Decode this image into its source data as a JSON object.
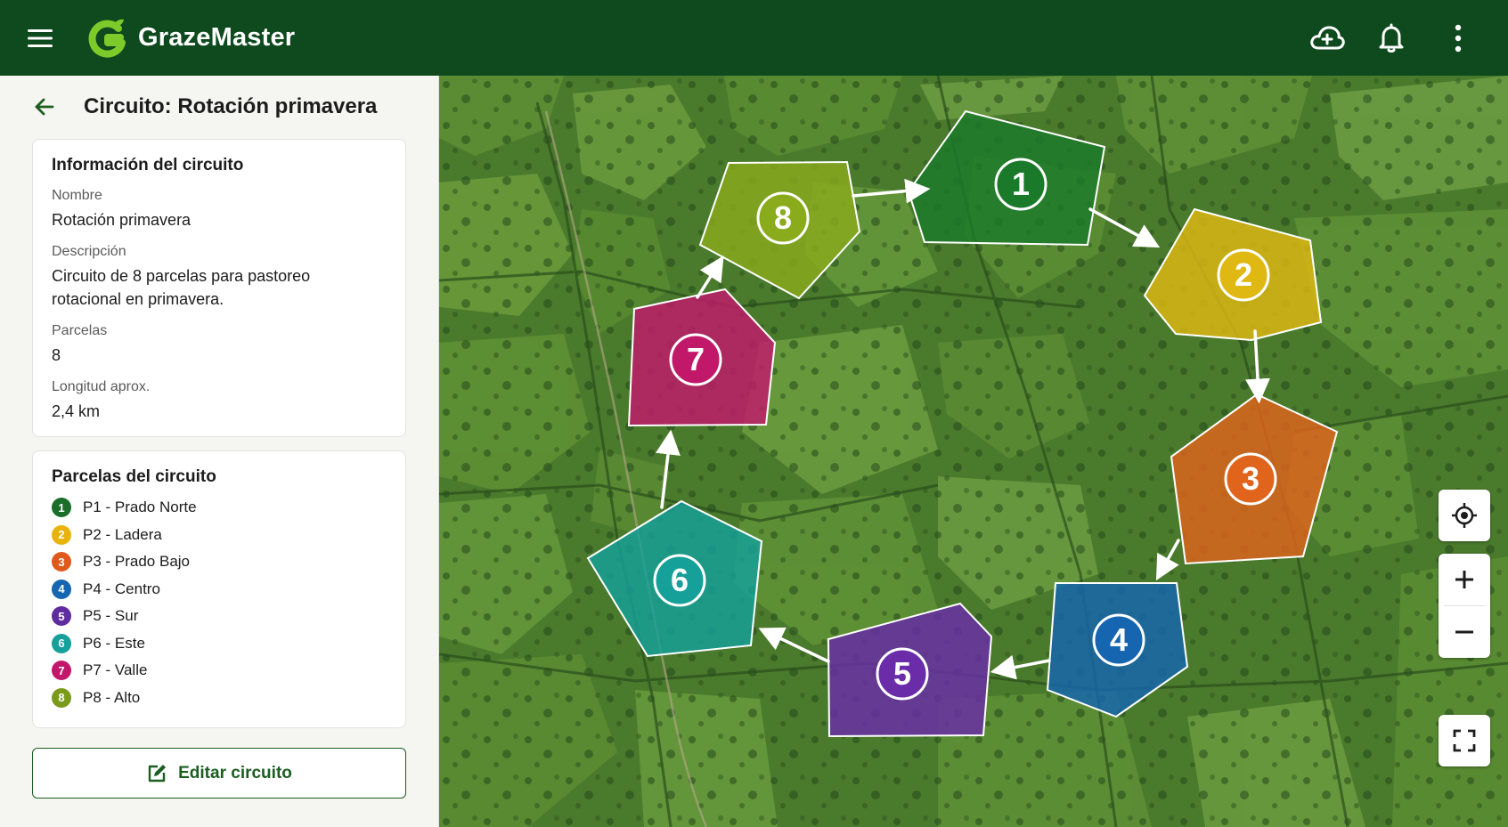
{
  "app": {
    "name": "GrazeMaster",
    "brand_color": "#0e4a1d",
    "icons": {
      "menu": "hamburger-menu-icon",
      "logo": "grazemaster-logo",
      "sync": "cloud-sync-icon",
      "notifications": "bell-icon",
      "more": "more-vert-icon"
    }
  },
  "sidebar": {
    "title": "Circuito: Rotación primavera",
    "info_card": {
      "title": "Información del circuito",
      "fields": [
        {
          "label": "Nombre",
          "value": "Rotación primavera"
        },
        {
          "label": "Descripción",
          "value": "Circuito de 8 parcelas para pastoreo rotacional en primavera."
        },
        {
          "label": "Parcelas",
          "value": "8"
        },
        {
          "label": "Longitud aprox.",
          "value": "2,4 km"
        }
      ]
    },
    "parcels_card": {
      "title": "Parcelas del circuito",
      "items": [
        {
          "num": "1",
          "name": "P1 - Prado Norte",
          "color": "#1b6e2a"
        },
        {
          "num": "2",
          "name": "P2 - Ladera",
          "color": "#e8b40c"
        },
        {
          "num": "3",
          "name": "P3 - Prado Bajo",
          "color": "#e0591c"
        },
        {
          "num": "4",
          "name": "P4 - Centro",
          "color": "#1565b0"
        },
        {
          "num": "5",
          "name": "P5 - Sur",
          "color": "#5e2c9e"
        },
        {
          "num": "6",
          "name": "P6 - Este",
          "color": "#15a09a"
        },
        {
          "num": "7",
          "name": "P7 - Valle",
          "color": "#c2186a"
        },
        {
          "num": "8",
          "name": "P8 - Alto",
          "color": "#7a9a1c"
        }
      ]
    },
    "edit_button": "Editar circuito"
  },
  "map": {
    "parcels": [
      {
        "num": "1",
        "color": "#1b7a2a"
      },
      {
        "num": "2",
        "color": "#e0b812"
      },
      {
        "num": "3",
        "color": "#e0641c"
      },
      {
        "num": "4",
        "color": "#1565b0"
      },
      {
        "num": "5",
        "color": "#6a2ca8"
      },
      {
        "num": "6",
        "color": "#15a09a"
      },
      {
        "num": "7",
        "color": "#c2186a"
      },
      {
        "num": "8",
        "color": "#8aab1c"
      }
    ],
    "controls": {
      "locate": "my-location-icon",
      "zoom_in": "zoom-in-icon",
      "zoom_out": "zoom-out-icon",
      "fullscreen": "fullscreen-icon"
    }
  }
}
